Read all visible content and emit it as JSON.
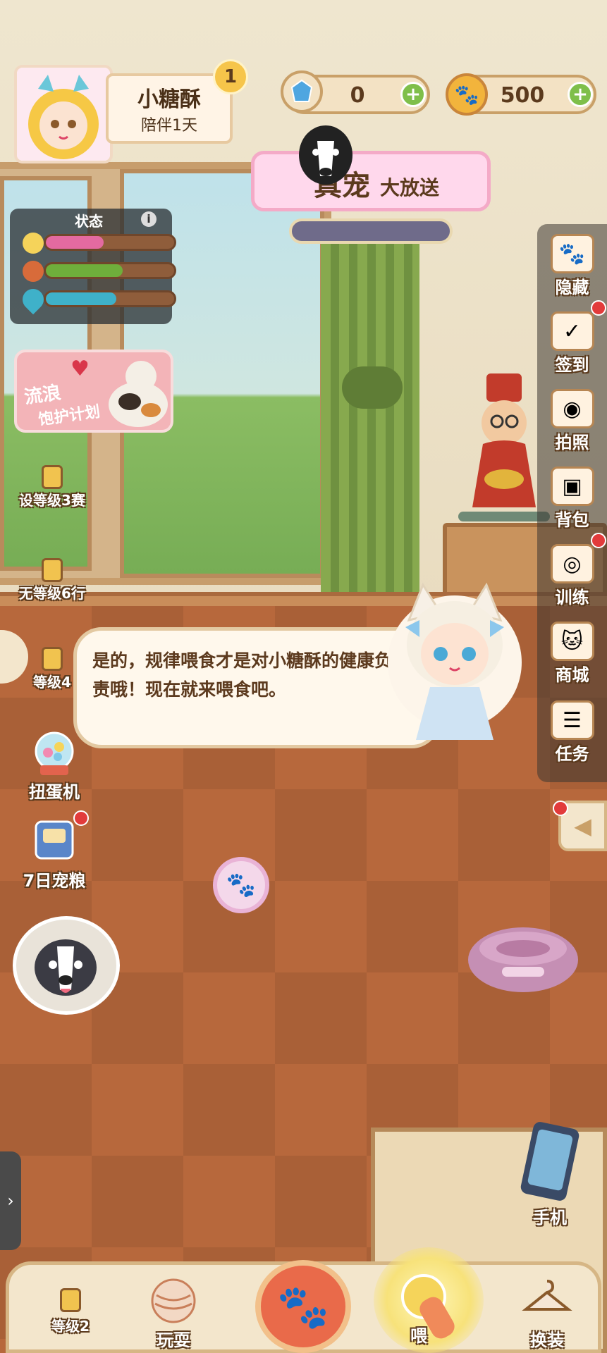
{
  "player": {
    "name": "小糖酥",
    "companion_days": "陪伴1天",
    "level": "1"
  },
  "currency": {
    "gems": "0",
    "paws": "500"
  },
  "event_banner": {
    "title_part1": "真宠",
    "title_part2": "大放送"
  },
  "status_panel": {
    "title": "状态",
    "info": "i",
    "mood": 0.45,
    "food": 0.6,
    "water": 0.55
  },
  "left_menu": {
    "stray_plan_line1": "流浪",
    "stray_plan_line2": "饱护计划",
    "locked_level3": "等级3",
    "locked_level3_bg": "设",
    "locked_level3_bg2": "赛",
    "locked_level6": "等级6",
    "locked_level6_bg": "无",
    "locked_level6_bg2": "行",
    "locked_level4": "等级4",
    "gacha": "扭蛋机",
    "seven_day_food": "7日宠粮"
  },
  "right_menu": {
    "hide": "隐藏",
    "checkin": "签到",
    "photo": "拍照",
    "bag": "背包",
    "train": "训练",
    "shop": "商城",
    "tasks": "任务"
  },
  "dialog": {
    "text": "是的，规律喂食才是对小糖酥的健康负责哦！现在就来喂食吧。"
  },
  "room": {
    "phone": "手机"
  },
  "bottom_nav": {
    "locked_level2": "等级2",
    "play": "玩耍",
    "feed": "喂",
    "dress_up": "换装"
  },
  "colors": {
    "accent_red": "#e23b3b",
    "bar_mood": "#e46aa0",
    "bar_food": "#6fae3b",
    "bar_water": "#3fb1c9",
    "dialog_text": "#5c3a1e"
  },
  "icons": [
    "paw-icon",
    "gem-icon",
    "plus-icon",
    "camera-icon",
    "bag-icon",
    "lock-icon",
    "dog-icon",
    "bowl-icon",
    "phone-icon",
    "calendar-icon",
    "shop-icon",
    "task-icon",
    "chevron-left-icon",
    "chevron-right-icon"
  ]
}
